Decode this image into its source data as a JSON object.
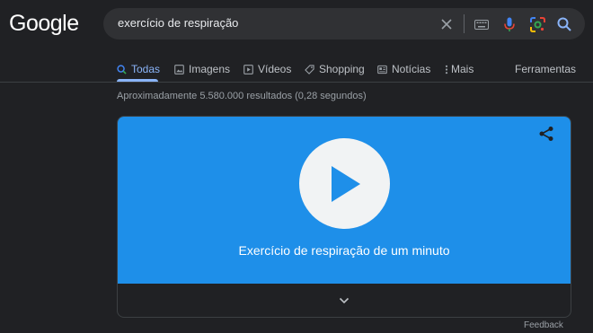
{
  "logo": "Google",
  "search": {
    "query": "exercício de respiração",
    "icons": [
      "close-icon",
      "keyboard-icon",
      "microphone-icon",
      "lens-icon",
      "search-icon"
    ]
  },
  "tabs": [
    {
      "label": "Todas",
      "icon": "search-icon",
      "active": true
    },
    {
      "label": "Imagens",
      "icon": "image-icon"
    },
    {
      "label": "Vídeos",
      "icon": "video-icon"
    },
    {
      "label": "Shopping",
      "icon": "tag-icon"
    },
    {
      "label": "Notícias",
      "icon": "news-icon"
    },
    {
      "label": "Mais",
      "icon": "more-vert-icon"
    }
  ],
  "tools_label": "Ferramentas",
  "result_stats": "Aproximadamente 5.580.000 resultados (0,28 segundos)",
  "card": {
    "title": "Exercício de respiração de um minuto",
    "background": "#1e8fe9"
  },
  "feedback": "Feedback",
  "colors": {
    "background": "#202124",
    "accent": "#8ab4f8",
    "card_blue": "#1e8fe9"
  }
}
